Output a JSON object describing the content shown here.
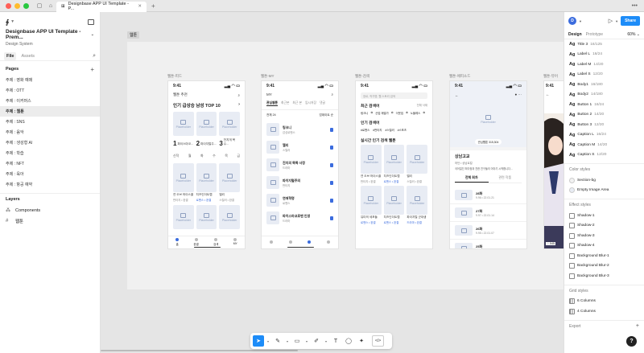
{
  "window": {
    "tab_title": "Designbase APP UI Template - P...",
    "colors": {
      "close": "#ff5f57",
      "minimize": "#febc2e",
      "maximize": "#28c840"
    }
  },
  "left_panel": {
    "file_title": "Designbase APP UI Template - Prem...",
    "file_subtitle": "Design System",
    "tabs": [
      "File",
      "Assets"
    ],
    "pages_label": "Pages",
    "pages": [
      "주제 : 영화 예매",
      "주제 : OTT",
      "주제 : 이커머스",
      "주제 : 웹툰",
      "주제 : SNS",
      "주제 : 음악",
      "주제 : 생성형 AI",
      "주제 : 학습",
      "주제 : NFT",
      "주제 : 육아",
      "주제 : 항공 예약"
    ],
    "active_page_index": 3,
    "layers_label": "Layers",
    "layers": [
      {
        "label": "Components",
        "icon": "components-icon"
      },
      {
        "label": "웹툰",
        "icon": "frame-hash-icon"
      }
    ]
  },
  "canvas": {
    "frame_label": "웹툰",
    "screens": [
      {
        "label": "웹툰-피드",
        "time": "9:41",
        "header": "웹툰 추천",
        "title": "인기 급상승 남성 TOP 10",
        "ranks": [
          {
            "num": "1",
            "name": "파이스마코..."
          },
          {
            "num": "2",
            "name": "파이지털주..."
          },
          {
            "num": "3",
            "name": "천지개 복수..."
          }
        ],
        "days": [
          "신작",
          "월",
          "화",
          "수",
          "목",
          "금"
        ],
        "cards": [
          {
            "name": "연 오브 하이스쿨",
            "meta": "판타지 • 완결"
          },
          {
            "name": "치즈인더트랩",
            "meta": "로맨스 • 완결"
          },
          {
            "name": "엘리",
            "meta": "스릴러 • 완결"
          }
        ],
        "nav": [
          "홈",
          "완결",
          "검색",
          "MY"
        ]
      },
      {
        "label": "웹툰-MY",
        "time": "9:41",
        "header": "MY",
        "tabs": [
          "관심웹툰",
          "최근본",
          "최근 본",
          "임시저장",
          "댓글"
        ],
        "sort_label": "업데이트 순",
        "count_label": "전체 24",
        "items": [
          {
            "title": "링크니",
            "sub": "감성로맨스"
          },
          {
            "title": "엘리",
            "sub": "스릴러"
          },
          {
            "title": "진지의 똑똑 사정",
            "sub": "드라마"
          },
          {
            "title": "파이지털주의",
            "sub": "판타지"
          },
          {
            "title": "연애혁명",
            "sub": "로맨스"
          },
          {
            "title": "파이스마코로맨 인생",
            "sub": "드라마"
          }
        ],
        "nav": [
          "홈",
          "완결",
          "검색",
          "MY"
        ]
      },
      {
        "label": "웹툰-검색",
        "time": "9:41",
        "search_placeholder": "장르, 작가명, 웹 스토리 검색",
        "recent_title": "최근 검색어",
        "recent_action": "전체 삭제",
        "recent_tags": [
          "링크니",
          "산업 재벌가",
          "이웃집",
          "노블레스"
        ],
        "popular_title": "인기 검색어",
        "popular_tags": [
          "#로맨스",
          "#판타지",
          "#스릴러",
          "#스포츠"
        ],
        "live_title": "실시간 인기 검색 웹툰",
        "cards": [
          {
            "name": "연 오브 하이스쿨",
            "meta": "판타지 • 완결"
          },
          {
            "name": "치즈인더트랩",
            "meta": "로맨스 • 완결"
          },
          {
            "name": "엘리",
            "meta": "스릴러 • 완결"
          },
          {
            "name": "유미의 세포들",
            "meta": "로맨스 • 완결"
          },
          {
            "name": "치즈인더트랩",
            "meta": "로맨스 • 완결"
          },
          {
            "name": "파이지털 군대생",
            "meta": "드라마 • 완결"
          }
        ]
      },
      {
        "label": "웹툰-에피소드",
        "time": "9:41",
        "rating": "관심웹툰 315,304",
        "title": "상남고교",
        "author": "하던 • 상남로컬",
        "description": "국어일진 최이정과 친한 친구들의 이야기 시작합니다...",
        "tabs": [
          "전체 회차",
          "관련 작품"
        ],
        "episodes": [
          {
            "num": "28화",
            "meta": "9.96 • 22.01.21"
          },
          {
            "num": "27화",
            "meta": "9.97 • 22.01.14"
          },
          {
            "num": "26화",
            "meta": "9.95 • 22.01.07"
          },
          {
            "num": "25화",
            "meta": "9.98 • 21.12.31"
          },
          {
            "num": "24화",
            "meta": "9.94 • 21.12.24"
          }
        ]
      },
      {
        "label": "웹툰-뷰어",
        "time": "9:41",
        "counter": "545"
      }
    ]
  },
  "right_panel": {
    "user_initial": "D",
    "share_label": "Share",
    "tabs": [
      "Design",
      "Prototype"
    ],
    "zoom": "60%",
    "text_styles": [
      {
        "name": "Title 3",
        "meta": "16/125"
      },
      {
        "name": "Label L",
        "meta": "16/24"
      },
      {
        "name": "Label M",
        "meta": "14/20"
      },
      {
        "name": "Label S",
        "meta": "12/20"
      },
      {
        "name": "Body1",
        "meta": "16/180"
      },
      {
        "name": "Body2",
        "meta": "14/180"
      },
      {
        "name": "Button 1",
        "meta": "16/24"
      },
      {
        "name": "Button 2",
        "meta": "14/20"
      },
      {
        "name": "Button 3",
        "meta": "12/20"
      },
      {
        "name": "Caption L",
        "meta": "16/24"
      },
      {
        "name": "Caption M",
        "meta": "14/20"
      },
      {
        "name": "Caption S",
        "meta": "12/20"
      }
    ],
    "color_styles_label": "Color styles",
    "color_styles": [
      {
        "name": "Section-bg",
        "color": "#f2f2f2"
      },
      {
        "name": "Empty Image Area",
        "color": "#e8ecf4"
      }
    ],
    "effect_styles_label": "Effect styles",
    "effect_styles": [
      "Shadow-1",
      "Shadow-2",
      "Shadow-3",
      "Shadow-4",
      "Background Blur-1",
      "Background Blur-2",
      "Background Blur-3"
    ],
    "grid_styles_label": "Grid styles",
    "grid_styles": [
      "6 Columns",
      "4 Columns"
    ],
    "export_label": "Export",
    "help_label": "?"
  },
  "toolbar": {
    "tools": [
      "move-tool",
      "pen-tool",
      "frame-tool",
      "pencil-tool",
      "text-tool",
      "comment-tool",
      "ai-tool",
      "dev-mode-tool"
    ],
    "code_label": "</>"
  },
  "placeholder_label": "Placeholder"
}
